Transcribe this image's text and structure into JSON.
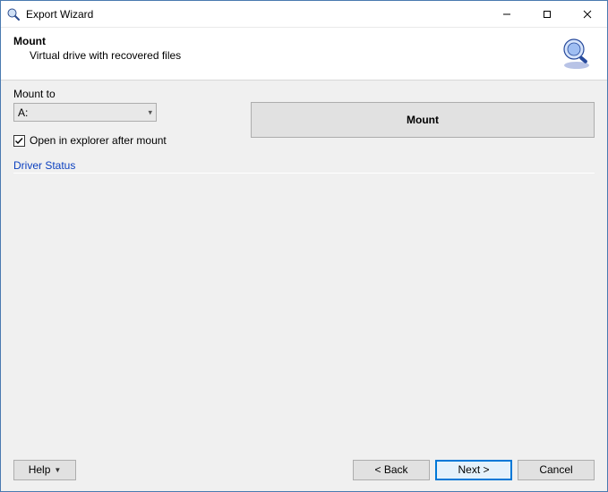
{
  "window": {
    "title": "Export Wizard"
  },
  "header": {
    "title": "Mount",
    "subtitle": "Virtual drive with recovered files"
  },
  "body": {
    "mount_to_label": "Mount to",
    "mount_to_value": "A:",
    "open_explorer_label": "Open in explorer after mount",
    "open_explorer_checked": true,
    "mount_button_label": "Mount",
    "driver_status_label": "Driver Status"
  },
  "footer": {
    "help_label": "Help",
    "back_label": "< Back",
    "next_label": "Next >",
    "cancel_label": "Cancel"
  }
}
